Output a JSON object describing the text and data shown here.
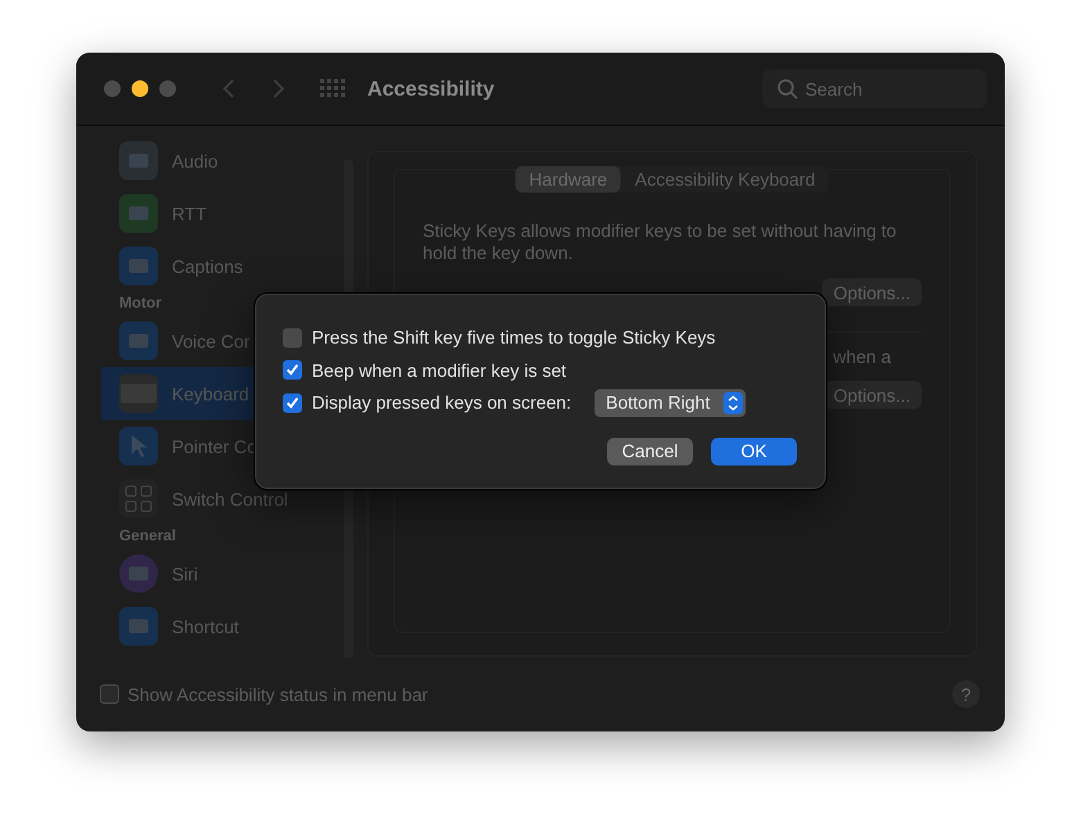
{
  "window": {
    "title": "Accessibility"
  },
  "search": {
    "placeholder": "Search"
  },
  "sidebar": {
    "items": [
      {
        "kind": "item",
        "label": "Audio",
        "selected": false
      },
      {
        "kind": "item",
        "label": "RTT",
        "selected": false
      },
      {
        "kind": "item",
        "label": "Captions",
        "selected": false
      },
      {
        "kind": "header",
        "label": "Motor"
      },
      {
        "kind": "item",
        "label": "Voice Cor",
        "selected": false
      },
      {
        "kind": "item",
        "label": "Keyboard",
        "selected": true
      },
      {
        "kind": "item",
        "label": "Pointer Co",
        "selected": false
      },
      {
        "kind": "item",
        "label": "Switch Control",
        "selected": false
      },
      {
        "kind": "header",
        "label": "General"
      },
      {
        "kind": "item",
        "label": "Siri",
        "selected": false
      },
      {
        "kind": "item",
        "label": "Shortcut",
        "selected": false
      }
    ]
  },
  "tabs": [
    {
      "label": "Hardware",
      "selected": true
    },
    {
      "label": "Accessibility Keyboard",
      "selected": false
    }
  ],
  "content": {
    "description": "Sticky Keys allows modifier keys to be set without having to hold the key down.",
    "options_button_1": "Options...",
    "partial_text": "when a",
    "options_button_2": "Options..."
  },
  "bottom": {
    "checkbox": {
      "label": "Show Accessibility status in menu bar",
      "checked": false
    },
    "help": "?"
  },
  "dialog": {
    "options": [
      {
        "kind": "checkbox",
        "label": "Press the Shift key five times to toggle Sticky Keys",
        "checked": false
      },
      {
        "kind": "checkbox",
        "label": "Beep when a modifier key is set",
        "checked": true
      },
      {
        "kind": "popup",
        "label": "Display pressed keys on screen:",
        "checked": true,
        "value": "Bottom Right"
      }
    ],
    "buttons": [
      {
        "label": "Cancel",
        "kind": "cancel"
      },
      {
        "label": "OK",
        "kind": "default"
      }
    ]
  }
}
